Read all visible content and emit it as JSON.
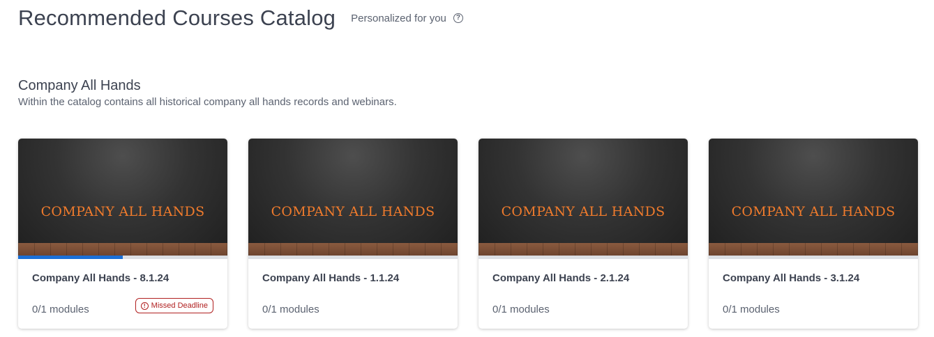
{
  "page": {
    "title": "Recommended Courses Catalog",
    "subtitle": "Personalized for you",
    "help_icon": "question-circle-icon"
  },
  "section": {
    "title": "Company All Hands",
    "description": "Within the catalog contains all historical company all hands records and webinars."
  },
  "cards": [
    {
      "thumbnail_text": "COMPANY ALL HANDS",
      "title": "Company All Hands - 8.1.24",
      "modules": "0/1 modules",
      "progress": 0.5,
      "badge": "Missed Deadline",
      "badge_icon": "info-circle-icon",
      "badge_color": "#b01f1f"
    },
    {
      "thumbnail_text": "COMPANY ALL HANDS",
      "title": "Company All Hands - 1.1.24",
      "modules": "0/1 modules",
      "progress": 0
    },
    {
      "thumbnail_text": "COMPANY ALL HANDS",
      "title": "Company All Hands - 2.1.24",
      "modules": "0/1 modules",
      "progress": 0
    },
    {
      "thumbnail_text": "COMPANY ALL HANDS",
      "title": "Company All Hands - 3.1.24",
      "modules": "0/1 modules",
      "progress": 0
    }
  ],
  "colors": {
    "accent": "#1b6fd6",
    "thumbnail_text": "#f07b2c",
    "warning": "#b01f1f"
  }
}
